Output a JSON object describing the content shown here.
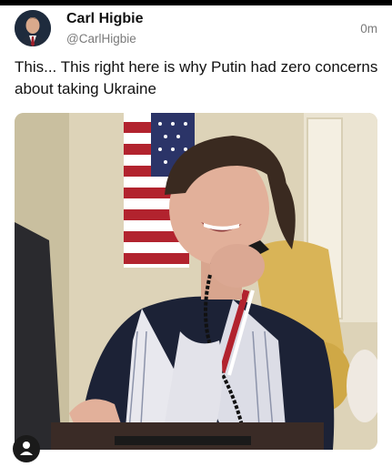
{
  "post": {
    "author_name": "Carl Higbie",
    "author_handle": "@CarlHigbie",
    "timestamp": "0m",
    "text": "This... This right here is why Putin had zero concerns about taking Ukraine"
  },
  "icons": {
    "avatar": "profile-photo",
    "corner": "account-icon"
  },
  "colors": {
    "name": "#111111",
    "secondary": "#7a7a7a",
    "background": "#ffffff"
  }
}
